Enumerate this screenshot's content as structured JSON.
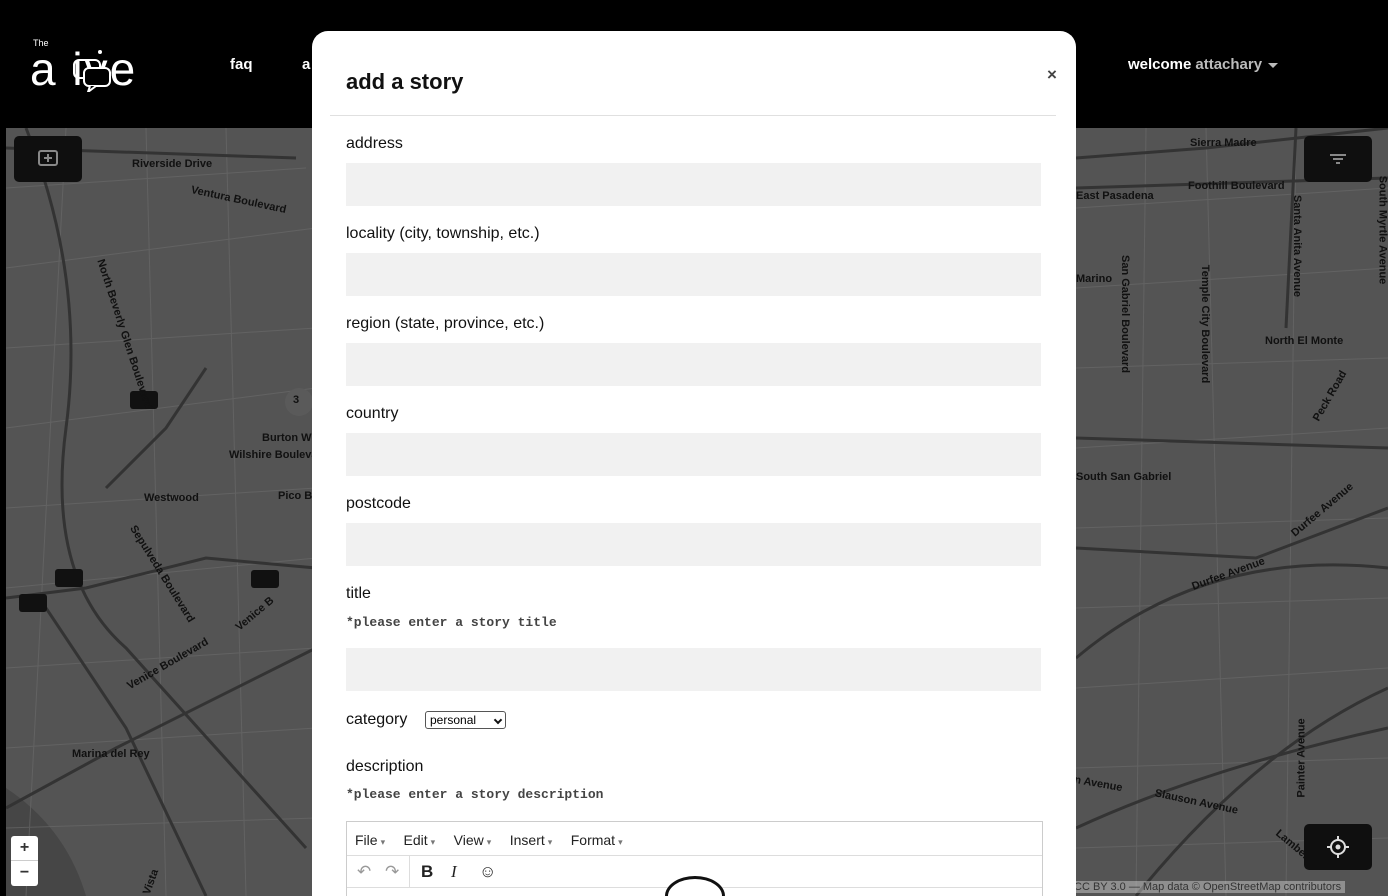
{
  "nav": {
    "logo_small": "The",
    "logo_text": "a   ive",
    "links": [
      "faq",
      "a"
    ],
    "welcome_label": "welcome",
    "username": "attachary"
  },
  "map": {
    "labels": {
      "riverside": "Riverside Drive",
      "ventura": "Ventura Boulevard",
      "beverly_glen": "North Beverly Glen Boulevard",
      "burton": "Burton W",
      "wilshire": "Wilshire Bouleva",
      "westwood": "Westwood",
      "pico": "Pico B",
      "sepulveda": "Sepulveda Boulevard",
      "venice_b": "Venice B",
      "venice": "Venice Boulevard",
      "marina": "Marina del Rey",
      "vista": "Vista",
      "sierra": "Sierra Madre",
      "east_pasadena": "East Pasadena",
      "foothill": "Foothill Boulevard",
      "santa_anita": "Santa Anita Avenue",
      "myrtle": "South Myrtle Avenue",
      "marino": "Marino",
      "san_gabriel_blvd": "San Gabriel Boulevard",
      "temple": "Temple City Boulevard",
      "north_el_monte": "North El Monte",
      "peck": "Peck Road",
      "south_san_gabriel": "South San Gabriel",
      "durfee": "Durfee Avenue",
      "avenue": "n Avenue",
      "slauson": "Slauson Avenue",
      "painter": "Painter Avenue",
      "lambert": "Lambert",
      "cluster": "3",
      "boulevard": "Boulevard"
    },
    "zoom_in": "+",
    "zoom_out": "−",
    "attribution": "CC BY 3.0 — Map data © OpenStreetMap contributors",
    "icons": {
      "add_story": "add-story-icon",
      "filter": "filter-icon",
      "locate": "locate-icon"
    }
  },
  "modal": {
    "title": "add a story",
    "close": "×",
    "fields": {
      "address": "address",
      "locality": "locality (city, township, etc.)",
      "region": "region (state, province, etc.)",
      "country": "country",
      "postcode": "postcode",
      "title": "title",
      "title_hint": "*please enter a story title",
      "category": "category",
      "category_value": "personal",
      "description": "description",
      "description_hint": "*please enter a story description"
    },
    "editor": {
      "menus": [
        "File",
        "Edit",
        "View",
        "Insert",
        "Format"
      ],
      "undo": "↶",
      "redo": "↷",
      "bold": "B",
      "italic": "I",
      "emoji": "☺"
    }
  }
}
